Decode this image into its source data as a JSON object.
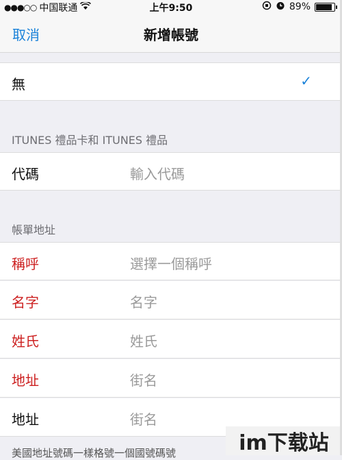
{
  "status_bar": {
    "signal": "●●●○○",
    "carrier": "中国联通",
    "wifi_icon": "wifi-icon",
    "time": "上午9:50",
    "battery": "89%",
    "battery_level": 0.89
  },
  "nav": {
    "cancel": "取消",
    "title": "新增帳號"
  },
  "payment_row": {
    "label": "無",
    "check": "✓"
  },
  "sections": {
    "itunes_header": "ITUNES 禮品卡和 ITUNES 禮品",
    "billing_header": "帳單地址"
  },
  "code_row": {
    "label": "代碼",
    "placeholder": "輸入代碼"
  },
  "billing_rows": [
    {
      "label": "稱呼",
      "value": "選擇一個稱呼"
    },
    {
      "label": "名字",
      "value": "名字"
    },
    {
      "label": "姓氏",
      "value": "姓氏"
    },
    {
      "label": "地址",
      "value": "街名"
    },
    {
      "label": "地址",
      "value": "街名"
    }
  ],
  "footer": {
    "text": "美國地址號碼一樣格號一個國號碼號"
  },
  "watermark": "im下载站",
  "colors": {
    "accent": "#1a82d9",
    "required": "#cc1f1f",
    "placeholder": "#9a9a9a",
    "background": "#efeff4"
  }
}
